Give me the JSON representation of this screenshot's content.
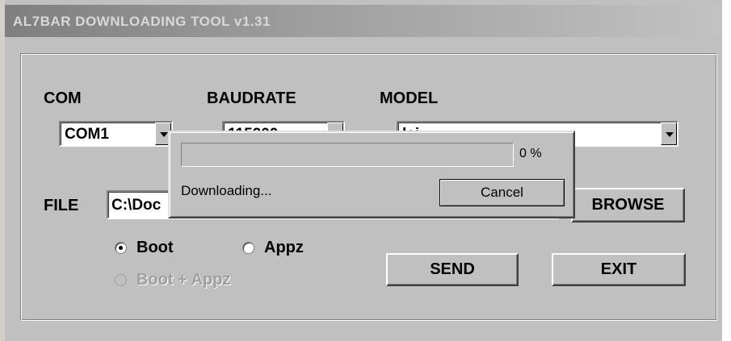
{
  "window": {
    "title": "AL7BAR DOWNLOADING TOOL v1.31"
  },
  "form": {
    "com": {
      "label": "COM",
      "value": "COM1"
    },
    "baudrate": {
      "label": "BAUDRATE",
      "value": "115200"
    },
    "model": {
      "label": "MODEL",
      "value": "lai"
    },
    "file": {
      "label": "FILE",
      "value": "C:\\Doc"
    },
    "browse_label": "BROWSE",
    "radios": {
      "boot": "Boot",
      "appz": "Appz",
      "boot_appz": "Boot + Appz",
      "selected": "Boot"
    },
    "send_label": "SEND",
    "exit_label": "EXIT"
  },
  "progress_dialog": {
    "percent_text": "0 %",
    "progress_fraction": 0,
    "status_text": "Downloading...",
    "cancel_label": "Cancel"
  },
  "colors": {
    "progress_fill": "#000080",
    "face": "#c0c0c0"
  }
}
